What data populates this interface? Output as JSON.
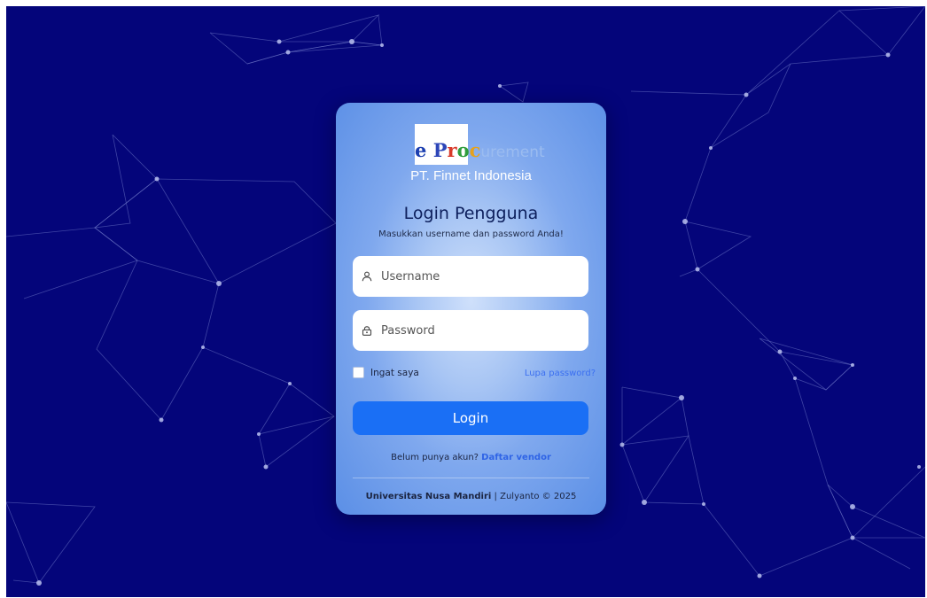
{
  "brand": {
    "logo_e": "e",
    "logo_p": "P",
    "logo_r": "r",
    "logo_o": "o",
    "logo_c": "c",
    "logo_rest": "urement",
    "company": "PT. Finnet Indonesia"
  },
  "login": {
    "title": "Login Pengguna",
    "subtitle": "Masukkan username dan password Anda!",
    "username_placeholder": "Username",
    "password_placeholder": "Password",
    "remember_label": "Ingat saya",
    "forgot_label": "Lupa password?",
    "submit_label": "Login",
    "register_prompt": "Belum punya akun?",
    "register_link": "Daftar vendor"
  },
  "footer": {
    "institution": "Universitas Nusa Mandiri",
    "separator": "|",
    "credit": "Zulyanto © 2025"
  },
  "colors": {
    "background": "#04057a",
    "button": "#1a6ff5",
    "link": "#3b6ff0"
  }
}
